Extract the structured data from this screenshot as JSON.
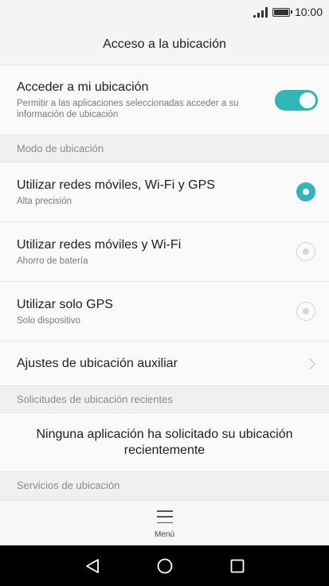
{
  "status_bar": {
    "time": "10:00"
  },
  "header": {
    "title": "Acceso a la ubicación"
  },
  "location_toggle": {
    "title": "Acceder a mi ubicación",
    "subtitle": "Permitir a las aplicaciones seleccionadas acceder a su información de ubicación",
    "enabled": true
  },
  "sections": {
    "mode": "Modo de ubicación",
    "recent_requests": "Solicitudes de ubicación recientes",
    "services": "Servicios de ubicación"
  },
  "mode_options": [
    {
      "title": "Utilizar redes móviles, Wi-Fi y GPS",
      "subtitle": "Alta precisión",
      "selected": true
    },
    {
      "title": "Utilizar redes móviles y Wi-Fi",
      "subtitle": "Ahorro de batería",
      "selected": false
    },
    {
      "title": "Utilizar solo GPS",
      "subtitle": "Solo dispositivo",
      "selected": false
    }
  ],
  "auxiliary": {
    "title": "Ajustes de ubicación auxiliar"
  },
  "recent_requests_message": "Ninguna aplicación ha solicitado su ubicación recientemente",
  "menu": {
    "label": "Menú"
  },
  "colors": {
    "accent": "#2fb6b6",
    "background": "#f4f4f4",
    "nav_bar": "#000000"
  },
  "icons": [
    "signal-icon",
    "battery-icon",
    "toggle-switch",
    "radio-selected-icon",
    "radio-unselected-icon",
    "chevron-right-icon",
    "hamburger-menu-icon",
    "back-icon",
    "home-icon",
    "recents-icon"
  ]
}
